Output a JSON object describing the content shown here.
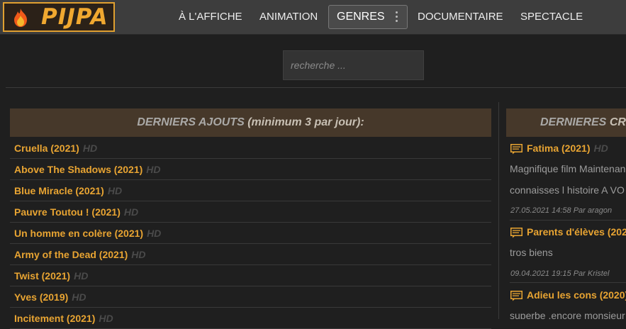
{
  "header": {
    "logo_text": "PIJPA",
    "nav": [
      {
        "label": "À L'AFFICHE"
      },
      {
        "label": "ANIMATION"
      },
      {
        "label": "GENRES"
      },
      {
        "label": "DOCUMENTAIRE"
      },
      {
        "label": "SPECTACLE"
      }
    ]
  },
  "search": {
    "placeholder": "recherche ..."
  },
  "latest": {
    "heading_main": "DERNIERS AJOUTS",
    "heading_note": "(minimum 3 par jour):",
    "badge": "HD",
    "items": [
      {
        "title": "Cruella (2021)"
      },
      {
        "title": "Above The Shadows (2021)"
      },
      {
        "title": "Blue Miracle (2021)"
      },
      {
        "title": "Pauvre Toutou ! (2021)"
      },
      {
        "title": "Un homme en colère (2021)"
      },
      {
        "title": "Army of the Dead (2021)"
      },
      {
        "title": "Twist (2021)"
      },
      {
        "title": "Yves (2019)"
      },
      {
        "title": "Incitement (2021)"
      }
    ]
  },
  "comments": {
    "heading_a": "DERNIERES",
    "heading_b": "CR",
    "items": [
      {
        "title": "Fatima (2021)",
        "badge": "HD",
        "lines": [
          "Magnifique film Maintenan",
          "connaisses l histoire A VO"
        ],
        "meta": "27.05.2021 14:58 Par aragon"
      },
      {
        "title": "Parents d'élèves (202",
        "badge": "",
        "lines": [
          "tros biens"
        ],
        "meta": "09.04.2021 19:15 Par Kristel"
      },
      {
        "title": "Adieu les cons (2020)",
        "badge": "",
        "lines": [
          "superbe ,encore monsieur"
        ],
        "meta": ""
      }
    ]
  },
  "colors": {
    "accent": "#e8a432",
    "header_bg": "#3d3d3d",
    "page_bg": "#1f1f1f",
    "section_head_bg": "#46382a"
  }
}
